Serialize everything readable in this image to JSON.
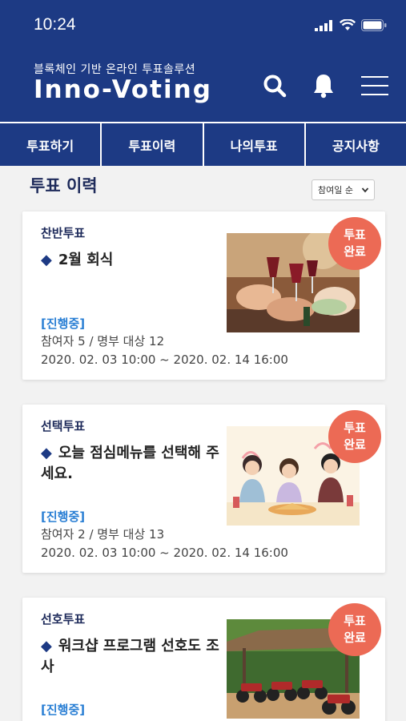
{
  "status_bar": {
    "time": "10:24"
  },
  "header": {
    "subtitle": "블록체인 기반 온라인 투표솔루션",
    "brand": "Inno-Voting"
  },
  "tabs": [
    {
      "label": "투표하기"
    },
    {
      "label": "투표이력"
    },
    {
      "label": "나의투표"
    },
    {
      "label": "공지사항"
    }
  ],
  "page": {
    "section_title": "투표 이력",
    "sort_selected": "참여일 순"
  },
  "cards": [
    {
      "type": "찬반투표",
      "title": "2월 회식",
      "status": "[진행중]",
      "participants": "참여자 5 / 명부 대상 12",
      "period": "2020. 02. 03 10:00 ~ 2020. 02. 14 16:00",
      "badge_line1": "투표",
      "badge_line2": "완료"
    },
    {
      "type": "선택투표",
      "title": "오늘 점심메뉴를 선택해 주세요.",
      "status": "[진행중]",
      "participants": "참여자 2 / 명부 대상 13",
      "period": "2020. 02. 03 10:00 ~ 2020. 02. 14 16:00",
      "badge_line1": "투표",
      "badge_line2": "완료"
    },
    {
      "type": "선호투표",
      "title": "워크샵 프로그램 선호도 조사",
      "status": "[진행중]",
      "badge_line1": "투표",
      "badge_line2": "완료"
    }
  ],
  "colors": {
    "header_bg": "#1d3a84",
    "badge": "#ec6a55",
    "status_blue": "#2a7fd4"
  }
}
